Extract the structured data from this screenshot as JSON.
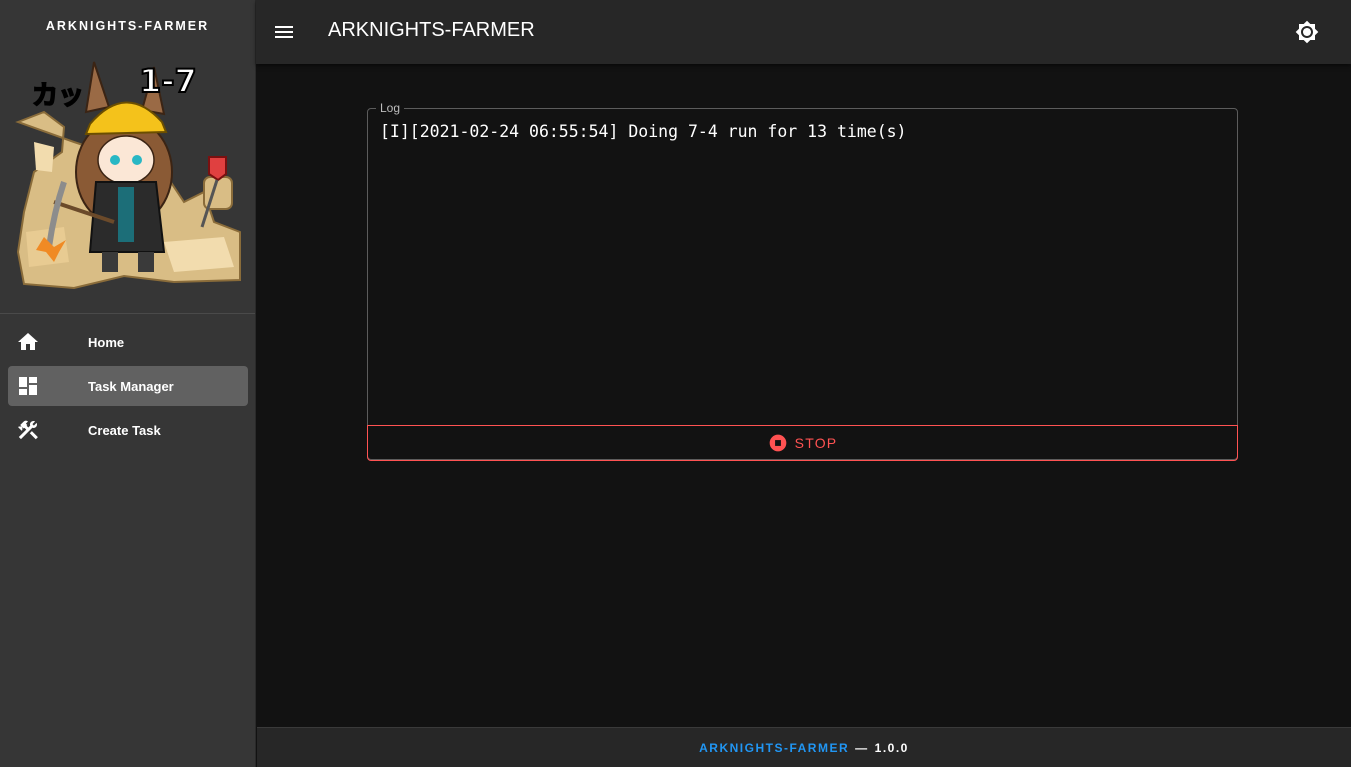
{
  "sidebar": {
    "title": "ARKNIGHTS-FARMER",
    "art_caption_left": "カッ",
    "art_caption_right": "1-7",
    "items": [
      {
        "label": "Home",
        "icon": "home-icon",
        "active": false
      },
      {
        "label": "Task Manager",
        "icon": "dashboard-icon",
        "active": true
      },
      {
        "label": "Create Task",
        "icon": "tools-icon",
        "active": false
      }
    ]
  },
  "header": {
    "title": "ARKNIGHTS-FARMER",
    "menu_icon": "menu-icon",
    "theme_icon": "brightness-icon"
  },
  "log": {
    "legend": "Log",
    "content": "[I][2021-02-24 06:55:54] Doing 7-4 run for 13 time(s)",
    "stop_label": "STOP",
    "stop_icon": "stop-circle-icon"
  },
  "footer": {
    "brand": "ARKNIGHTS-FARMER",
    "separator": "—",
    "version": "1.0.0"
  },
  "colors": {
    "accent": "#2196f3",
    "danger": "#ff5252",
    "background": "#121212",
    "sidebar": "#363636",
    "appbar": "#272727"
  }
}
